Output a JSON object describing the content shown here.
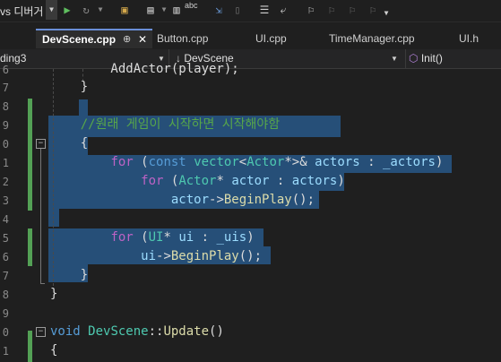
{
  "toolbar": {
    "debug_label": "vs 디버거",
    "spell_label": "abc"
  },
  "tabs": [
    {
      "label": "DevScene.cpp",
      "active": true
    },
    {
      "label": "Button.cpp"
    },
    {
      "label": "UI.cpp"
    },
    {
      "label": "TimeManager.cpp"
    },
    {
      "label": "UI.h"
    }
  ],
  "tab_pin": "⊕",
  "tab_close": "✕",
  "navbar": {
    "project": "ding3",
    "scope": "DevScene",
    "member": "Init()"
  },
  "editor": {
    "lines": [
      {
        "num": "6",
        "tokens": [
          {
            "t": "        AddActor(player);",
            "c": "tx"
          }
        ]
      },
      {
        "num": "7",
        "tokens": [
          {
            "t": "    }",
            "c": "tx"
          }
        ]
      },
      {
        "num": "8",
        "tokens": []
      },
      {
        "num": "9",
        "tokens": [
          {
            "t": "    //원래 게임이 시작하면 시작해야함",
            "c": "cm"
          }
        ]
      },
      {
        "num": "0",
        "tokens": [
          {
            "t": "    {",
            "c": "tx"
          }
        ]
      },
      {
        "num": "1",
        "tokens": [
          {
            "t": "        ",
            "c": "tx"
          },
          {
            "t": "for",
            "c": "mac"
          },
          {
            "t": " (",
            "c": "tx"
          },
          {
            "t": "const",
            "c": "kw"
          },
          {
            "t": " ",
            "c": "tx"
          },
          {
            "t": "vector",
            "c": "ty"
          },
          {
            "t": "<",
            "c": "tx"
          },
          {
            "t": "Actor",
            "c": "ty"
          },
          {
            "t": "*>& ",
            "c": "tx"
          },
          {
            "t": "actors",
            "c": "vr"
          },
          {
            "t": " : ",
            "c": "tx"
          },
          {
            "t": "_actors",
            "c": "vr"
          },
          {
            "t": ")",
            "c": "tx"
          }
        ]
      },
      {
        "num": "2",
        "tokens": [
          {
            "t": "            ",
            "c": "tx"
          },
          {
            "t": "for",
            "c": "mac"
          },
          {
            "t": " (",
            "c": "tx"
          },
          {
            "t": "Actor",
            "c": "ty"
          },
          {
            "t": "* ",
            "c": "tx"
          },
          {
            "t": "actor",
            "c": "vr"
          },
          {
            "t": " : ",
            "c": "tx"
          },
          {
            "t": "actors",
            "c": "vr"
          },
          {
            "t": ")",
            "c": "tx"
          }
        ]
      },
      {
        "num": "3",
        "tokens": [
          {
            "t": "                ",
            "c": "tx"
          },
          {
            "t": "actor",
            "c": "vr"
          },
          {
            "t": "->",
            "c": "tx"
          },
          {
            "t": "BeginPlay",
            "c": "fn"
          },
          {
            "t": "();",
            "c": "tx"
          }
        ]
      },
      {
        "num": "4",
        "tokens": []
      },
      {
        "num": "5",
        "tokens": [
          {
            "t": "        ",
            "c": "tx"
          },
          {
            "t": "for",
            "c": "mac"
          },
          {
            "t": " (",
            "c": "tx"
          },
          {
            "t": "UI",
            "c": "ty"
          },
          {
            "t": "* ",
            "c": "tx"
          },
          {
            "t": "ui",
            "c": "vr"
          },
          {
            "t": " : ",
            "c": "tx"
          },
          {
            "t": "_uis",
            "c": "vr"
          },
          {
            "t": ")",
            "c": "tx"
          }
        ]
      },
      {
        "num": "6",
        "tokens": [
          {
            "t": "            ",
            "c": "tx"
          },
          {
            "t": "ui",
            "c": "vr"
          },
          {
            "t": "->",
            "c": "tx"
          },
          {
            "t": "BeginPlay",
            "c": "fn"
          },
          {
            "t": "();",
            "c": "tx"
          }
        ]
      },
      {
        "num": "7",
        "tokens": [
          {
            "t": "    }",
            "c": "tx"
          }
        ]
      },
      {
        "num": "8",
        "tokens": [
          {
            "t": "}",
            "c": "tx"
          }
        ]
      },
      {
        "num": "9",
        "tokens": []
      },
      {
        "num": "0",
        "tokens": [
          {
            "t": "void",
            "c": "kw"
          },
          {
            "t": " ",
            "c": "tx"
          },
          {
            "t": "DevScene",
            "c": "ty"
          },
          {
            "t": "::",
            "c": "tx"
          },
          {
            "t": "Update",
            "c": "fn"
          },
          {
            "t": "()",
            "c": "tx"
          }
        ]
      },
      {
        "num": "1",
        "tokens": [
          {
            "t": "{",
            "c": "tx"
          }
        ]
      }
    ]
  }
}
